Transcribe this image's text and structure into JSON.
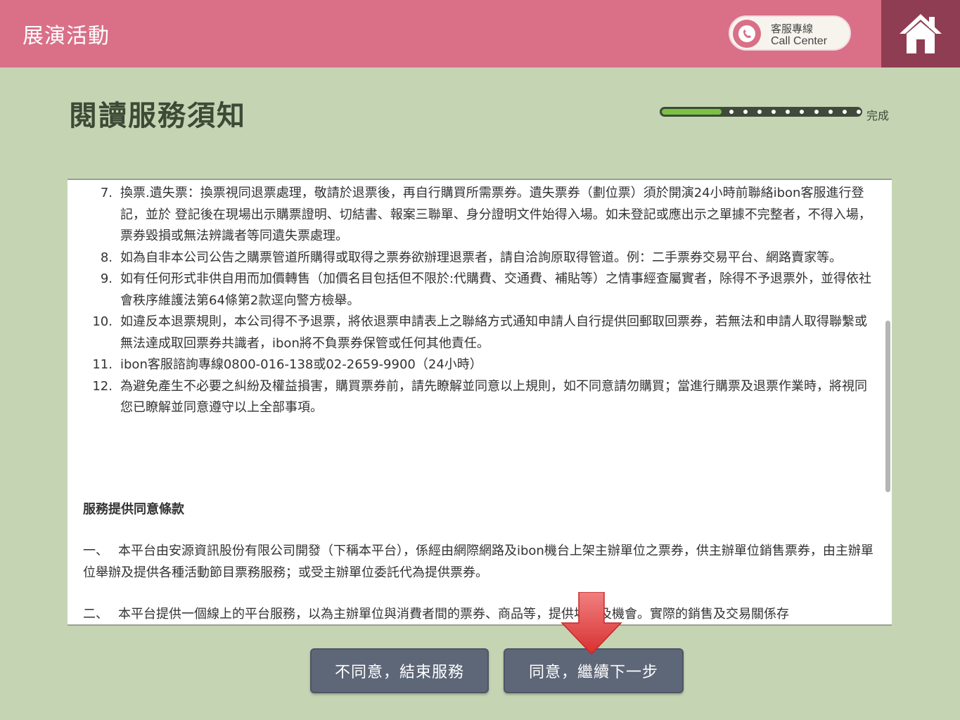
{
  "header": {
    "title": "展演活動",
    "call_center_line1": "客服專線",
    "call_center_line2": "Call Center",
    "accent": "#d97088"
  },
  "page": {
    "title": "閱讀服務須知",
    "progress_label": "完成",
    "progress_fraction": 0.3
  },
  "terms": {
    "items": [
      {
        "num": "7.",
        "text": "換票.遺失票：換票視同退票處理，敬請於退票後，再自行購買所需票券。遺失票券（劃位票）須於開演24小時前聯絡ibon客服進行登記，並於 登記後在現場出示購票證明、切結書、報案三聯單、身分證明文件始得入場。如未登記或應出示之單據不完整者，不得入場，票券毀損或無法辨識者等同遺失票處理。"
      },
      {
        "num": "8.",
        "text": "如為自非本公司公告之購票管道所購得或取得之票券欲辦理退票者，請自洽詢原取得管道。例：二手票券交易平台、網路賣家等。"
      },
      {
        "num": "9.",
        "text": "如有任何形式非供自用而加價轉售（加價名目包括但不限於:代購費、交通費、補貼等）之情事經查屬實者，除得不予退票外，並得依社會秩序維護法第64條第2款逕向警方檢舉。"
      },
      {
        "num": "10.",
        "text": "如違反本退票規則，本公司得不予退票，將依退票申請表上之聯絡方式通知申請人自行提供回郵取回票券，若無法和申請人取得聯繫或無法達成取回票券共識者，ibon將不負票券保管或任何其他責任。"
      },
      {
        "num": "11.",
        "text": "ibon客服諮詢專線0800-016-138或02-2659-9900（24小時）"
      },
      {
        "num": "12.",
        "text": "為避免產生不必要之糾紛及權益損害，購買票券前，請先瞭解並同意以上規則，如不同意請勿購買；當進行購票及退票作業時，將視同您已瞭解並同意遵守以上全部事項。"
      }
    ],
    "section_heading": "服務提供同意條款",
    "clauses": [
      {
        "num": "一、",
        "text": "本平台由安源資訊股份有限公司開發（下稱本平台），係經由網際網路及ibon機台上架主辦單位之票券，供主辦單位銷售票券，由主辦單位舉辦及提供各種活動節目票務服務；或受主辦單位委託代為提供票券。"
      },
      {
        "num": "二、",
        "text": "本平台提供一個線上的平台服務，以為主辦單位與消費者間的票券、商品等，提供場所及機會。實際的銷售及交易關係存"
      }
    ]
  },
  "buttons": {
    "disagree": "不同意，結束服務",
    "agree": "同意，繼續下一步"
  }
}
